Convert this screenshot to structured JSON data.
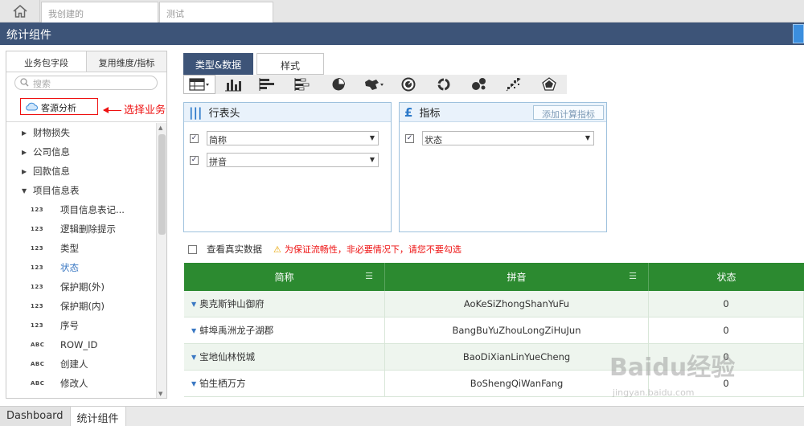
{
  "topbar": {
    "tabs": [
      {
        "label": "我创建的"
      },
      {
        "label": "测试"
      }
    ]
  },
  "titlebar": {
    "title": "统计组件"
  },
  "left_panel": {
    "tabs": [
      {
        "label": "业务包字段",
        "active": true
      },
      {
        "label": "复用维度/指标",
        "active": false
      }
    ],
    "search_placeholder": "搜索",
    "package": {
      "label": "客源分析"
    },
    "annotation": "选择业务包",
    "tree": [
      {
        "kind": "group",
        "label": "财物损失",
        "expanded": false
      },
      {
        "kind": "group",
        "label": "公司信息",
        "expanded": false
      },
      {
        "kind": "group",
        "label": "回款信息",
        "expanded": false
      },
      {
        "kind": "group",
        "label": "项目信息表",
        "expanded": true
      },
      {
        "kind": "field",
        "type": "123",
        "label": "项目信息表记..."
      },
      {
        "kind": "field",
        "type": "123",
        "label": "逻辑删除提示"
      },
      {
        "kind": "field",
        "type": "123",
        "label": "类型"
      },
      {
        "kind": "field",
        "type": "123",
        "label": "状态",
        "selected": true
      },
      {
        "kind": "field",
        "type": "123",
        "label": "保护期(外)"
      },
      {
        "kind": "field",
        "type": "123",
        "label": "保护期(内)"
      },
      {
        "kind": "field",
        "type": "123",
        "label": "序号"
      },
      {
        "kind": "field",
        "type": "ABC",
        "label": "ROW_ID"
      },
      {
        "kind": "field",
        "type": "ABC",
        "label": "创建人"
      },
      {
        "kind": "field",
        "type": "ABC",
        "label": "修改人"
      }
    ]
  },
  "main": {
    "tabs": [
      {
        "label": "类型&数据",
        "active": true
      },
      {
        "label": "样式",
        "active": false
      }
    ],
    "chart_tools": [
      "table-icon",
      "bar-chart-icon",
      "horizontal-bar-icon",
      "stacked-bar-icon",
      "pie-chart-icon",
      "scatter-icon",
      "gauge-icon",
      "donut-icon",
      "bubble-icon",
      "heatmap-icon",
      "radar-icon"
    ],
    "row_header": {
      "title": "行表头",
      "fields": [
        {
          "label": "简称",
          "checked": true
        },
        {
          "label": "拼音",
          "checked": true
        }
      ]
    },
    "indicator": {
      "title": "指标",
      "add_button": "添加计算指标",
      "fields": [
        {
          "label": "状态",
          "checked": true
        }
      ]
    },
    "real_data": {
      "label": "查看真实数据",
      "warning": "为保证流畅性，非必要情况下，请您不要勾选"
    },
    "table": {
      "columns": [
        "简称",
        "拼音",
        "状态"
      ],
      "rows": [
        [
          "奥克斯钟山御府",
          "AoKeSiZhongShanYuFu",
          "0"
        ],
        [
          "蚌埠禹洲龙子湖郡",
          "BangBuYuZhouLongZiHuJun",
          "0"
        ],
        [
          "宝地仙林悦城",
          "BaoDiXianLinYueCheng",
          "0"
        ],
        [
          "铂生栖万方",
          "BoShengQiWanFang",
          "0"
        ]
      ]
    }
  },
  "bottombar": {
    "tabs": [
      {
        "label": "Dashboard",
        "active": false
      },
      {
        "label": "统计组件",
        "active": true
      }
    ]
  },
  "watermark": {
    "brand": "Baidu经验",
    "url": "jingyan.baidu.com"
  },
  "colors": {
    "titlebar": "#3d5478",
    "table_header": "#2c8a30",
    "accent_blue": "#3a78c3",
    "warning_red": "#e11111"
  }
}
